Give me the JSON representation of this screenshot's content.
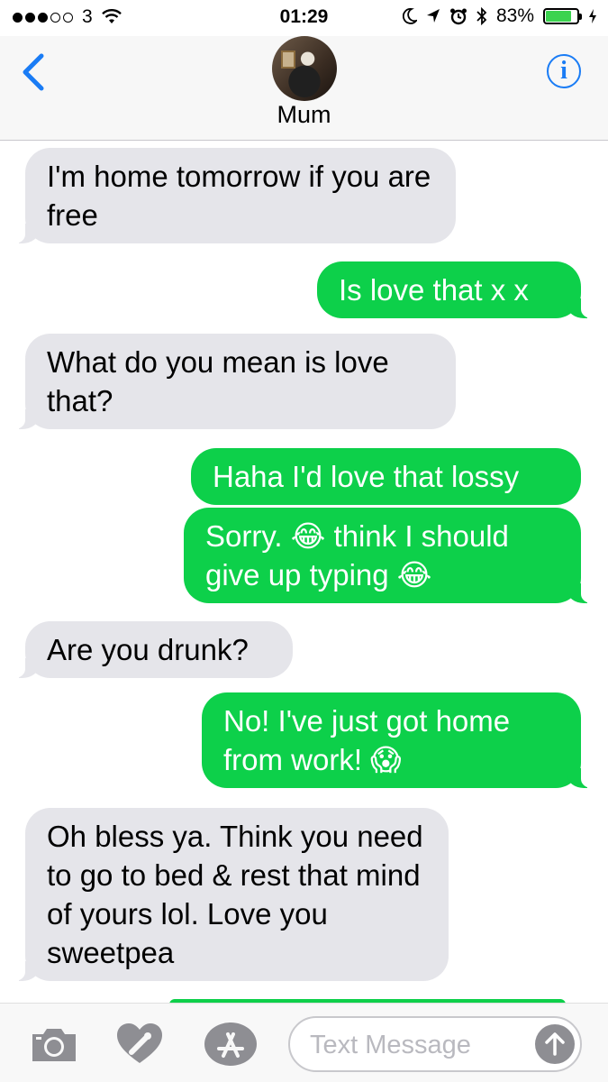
{
  "status_bar": {
    "carrier": "3",
    "time": "01:29",
    "battery": "83%",
    "battery_level": 0.83
  },
  "header": {
    "contact_name": "Mum",
    "back_icon": "chevron-left-icon",
    "info_icon": "info-icon"
  },
  "messages": [
    {
      "direction": "in",
      "text": "I'm home tomorrow if you are free"
    },
    {
      "direction": "out",
      "text": "Is love that x x"
    },
    {
      "direction": "in",
      "text": "What do you mean is love that?"
    },
    {
      "direction": "out",
      "text": "Haha I'd love that lossy"
    },
    {
      "direction": "out",
      "text": "Sorry. 😂  think I should give up typing 😂"
    },
    {
      "direction": "in",
      "text": "Are you drunk?"
    },
    {
      "direction": "out",
      "text": "No! I've just got home from work! 😱"
    },
    {
      "direction": "in",
      "text": "Oh bless ya. Think you need to go to bed & rest that mind of yours lol. Love you sweetpea"
    }
  ],
  "input_bar": {
    "placeholder": "Text Message",
    "icons": [
      "camera-icon",
      "digital-touch-icon",
      "app-store-icon",
      "send-arrow-icon"
    ]
  }
}
